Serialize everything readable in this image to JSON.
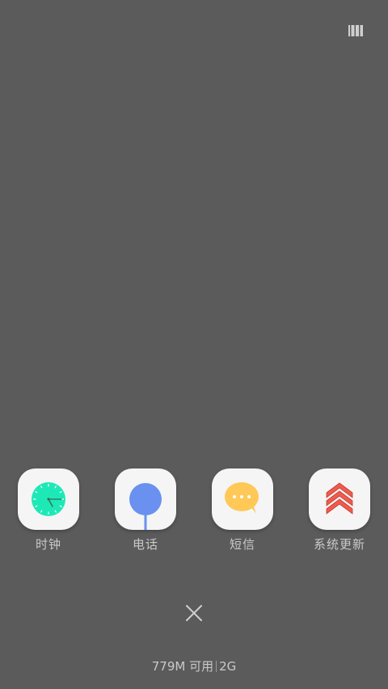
{
  "header": {
    "toggle_icon": "view-toggle-icon"
  },
  "apps": [
    {
      "label": "时钟",
      "icon": "clock-icon",
      "color": "#1de9b6"
    },
    {
      "label": "电话",
      "icon": "phone-icon",
      "color": "#6a90f0"
    },
    {
      "label": "短信",
      "icon": "message-icon",
      "color": "#ffc857"
    },
    {
      "label": "系统更新",
      "icon": "system-update-icon",
      "color": "#ef5b4c"
    }
  ],
  "close": {
    "icon": "close-icon"
  },
  "memory": {
    "available": "779M 可用",
    "total": "2G"
  }
}
